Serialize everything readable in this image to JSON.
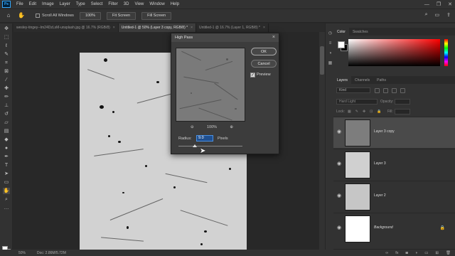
{
  "app": {
    "logo_text": "Ps",
    "menu": [
      "File",
      "Edit",
      "Image",
      "Layer",
      "Type",
      "Select",
      "Filter",
      "3D",
      "View",
      "Window",
      "Help"
    ],
    "window_controls": [
      "—",
      "❐",
      "✕"
    ]
  },
  "options_bar": {
    "scroll_all_label": "Scroll All Windows",
    "zoom_value": "100%",
    "fit_screen_label": "Fit Screen",
    "fill_screen_label": "Fill Screen"
  },
  "tabs": [
    {
      "label": "wesley-tingey--Im24DzLsM-unsplash.jpg @ 16.7% (RGB/8)",
      "close": "×"
    },
    {
      "label": "Untitled-1 @ 50% (Layer 3 copy, RGB/8) *",
      "close": "×"
    },
    {
      "label": "Untitled-1 @ 16.7% (Layer 1, RGB/8) *",
      "close": "×"
    }
  ],
  "status": {
    "zoom": "50%",
    "doc_info": "Doc: 2.86M/5.72M"
  },
  "color_panel": {
    "tabs": [
      "Color",
      "Swatches"
    ]
  },
  "layers_panel": {
    "tabs": [
      "Layers",
      "Channels",
      "Paths"
    ],
    "search_placeholder": "Kind",
    "blend_mode": "Hard Light",
    "opacity_label": "Opacity:",
    "lock_label": "Lock:",
    "fill_label": "Fill:",
    "layers": [
      {
        "name": "Layer 3 copy",
        "selected": true
      },
      {
        "name": "Layer 3",
        "selected": false
      },
      {
        "name": "Layer 2",
        "selected": false
      },
      {
        "name": "Background",
        "selected": false
      }
    ]
  },
  "high_pass_dialog": {
    "title": "High Pass",
    "ok_label": "OK",
    "cancel_label": "Cancel",
    "preview_label": "Preview",
    "preview_checked": true,
    "zoom_level": "100%",
    "radius_label": "Radius:",
    "radius_value": "9.0",
    "radius_unit": "Pixels"
  }
}
